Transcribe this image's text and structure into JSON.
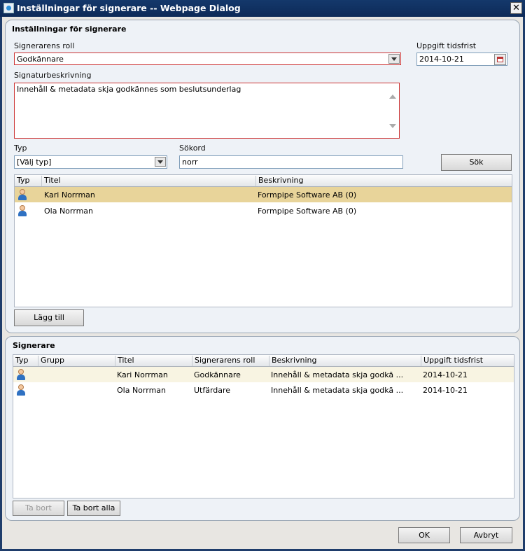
{
  "window": {
    "title": "Inställningar för signerare -- Webpage Dialog"
  },
  "settings": {
    "section_title": "Inställningar för signerare",
    "role_label": "Signerarens roll",
    "role_value": "Godkännare",
    "due_label": "Uppgift tidsfrist",
    "due_value": "2014-10-21",
    "desc_label": "Signaturbeskrivning",
    "desc_value": "Innehåll & metadata skja godkännes som beslutsunderlag",
    "type_label": "Typ",
    "type_value": "[Välj typ]",
    "keyword_label": "Sökord",
    "keyword_value": "norr",
    "search_button": "Sök",
    "add_button": "Lägg till"
  },
  "search_results": {
    "columns": [
      "Typ",
      "Titel",
      "Beskrivning"
    ],
    "rows": [
      {
        "title": "Kari Norrman",
        "description": "Formpipe Software AB (0)",
        "selected": true
      },
      {
        "title": "Ola Norrman",
        "description": "Formpipe Software AB (0)",
        "selected": false
      }
    ]
  },
  "signers": {
    "section_title": "Signerare",
    "columns": [
      "Typ",
      "Grupp",
      "Titel",
      "Signerarens roll",
      "Beskrivning",
      "Uppgift tidsfrist"
    ],
    "rows": [
      {
        "group": "",
        "title": "Kari Norrman",
        "role": "Godkännare",
        "description": "Innehåll & metadata skja godkä ...",
        "due": "2014-10-21"
      },
      {
        "group": "",
        "title": "Ola Norrman",
        "role": "Utfärdare",
        "description": "Innehåll & metadata skja godkä ...",
        "due": "2014-10-21"
      }
    ],
    "remove_button": "Ta bort",
    "remove_all_button": "Ta bort alla"
  },
  "footer": {
    "ok_button": "OK",
    "cancel_button": "Avbryt"
  },
  "colors": {
    "selected_row": "#e8d49a",
    "alt_row": "#f8f4e2"
  },
  "icons": {
    "row_type": "user-icon",
    "date_picker": "calendar-icon"
  }
}
